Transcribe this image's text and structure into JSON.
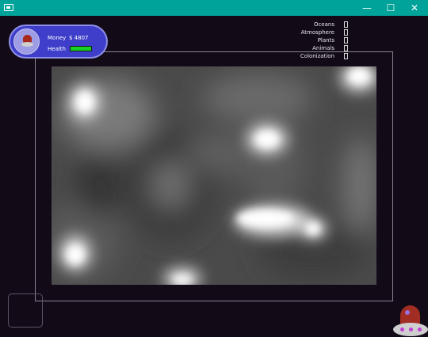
{
  "window": {
    "app_icon": "app-window-icon",
    "minimize_glyph": "—",
    "maximize_glyph": "☐",
    "close_glyph": "✕"
  },
  "hud": {
    "avatar_icon": "ufo-avatar-icon",
    "money_label": "Money",
    "money_value": "$ 4807",
    "health_label": "Health",
    "health_level": 1.0,
    "health_color": "#17d222"
  },
  "progress": {
    "items": [
      {
        "label": "Oceans",
        "level": 0
      },
      {
        "label": "Atmosphere",
        "level": 0
      },
      {
        "label": "Plants",
        "level": 0
      },
      {
        "label": "Animals",
        "level": 0
      },
      {
        "label": "Colonization",
        "level": 0
      }
    ]
  },
  "map": {
    "style": "grayscale heightmap with bright hot spots"
  },
  "ship": {
    "icon": "ufo-ship-icon"
  },
  "colors": {
    "titlebar": "#00a39a",
    "background": "#130a18",
    "hud_panel": "#3e3eca"
  }
}
